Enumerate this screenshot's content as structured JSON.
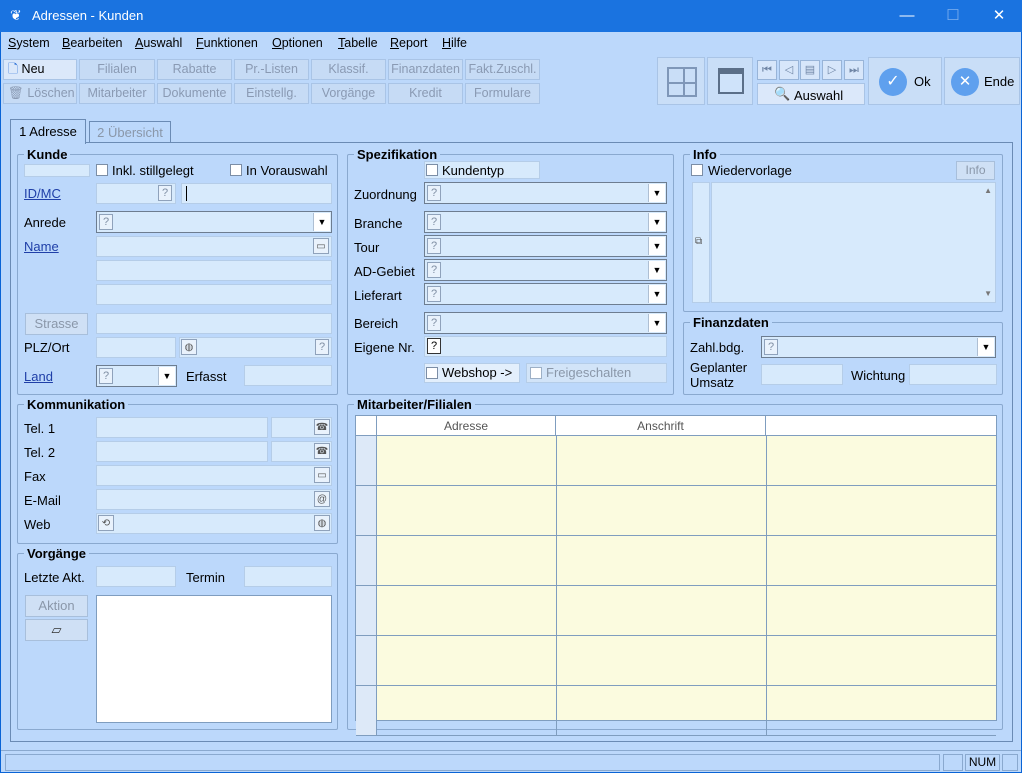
{
  "window": {
    "title": "Adressen - Kunden",
    "minimize": "—",
    "maximize": "☐",
    "close": "✕"
  },
  "menu": [
    {
      "label": "System",
      "u": "S"
    },
    {
      "label": "Bearbeiten",
      "u": "B"
    },
    {
      "label": "Auswahl",
      "u": "A"
    },
    {
      "label": "Funktionen",
      "u": "F"
    },
    {
      "label": "Optionen",
      "u": "O"
    },
    {
      "label": "Tabelle",
      "u": "T"
    },
    {
      "label": "Report",
      "u": "R"
    },
    {
      "label": "Hilfe",
      "u": "H"
    }
  ],
  "toolbar": {
    "neu": "Neu",
    "loeschen": "Löschen",
    "row1": [
      "Filialen",
      "Rabatte",
      "Pr.-Listen",
      "Klassif.",
      "Finanzdaten",
      "Fakt.Zuschl."
    ],
    "row2": [
      "Mitarbeiter",
      "Dokumente",
      "Einstellg.",
      "Vorgänge",
      "Kredit",
      "Formulare"
    ],
    "auswahl": "Auswahl",
    "ok": "Ok",
    "ende": "Ende"
  },
  "tabs": {
    "t1": "1 Adresse",
    "t2": "2 Übersicht"
  },
  "kunde": {
    "title": "Kunde",
    "inkl": "Inkl. stillgelegt",
    "vorauswahl": "In Vorauswahl",
    "idmc": "ID/MC",
    "anrede": "Anrede",
    "name": "Name",
    "strasse": "Strasse",
    "plzort": "PLZ/Ort",
    "land": "Land",
    "erfasst": "Erfasst"
  },
  "spez": {
    "title": "Spezifikation",
    "kundentyp": "Kundentyp",
    "zuordnung": "Zuordnung",
    "branche": "Branche",
    "tour": "Tour",
    "adgebiet": "AD-Gebiet",
    "lieferart": "Lieferart",
    "bereich": "Bereich",
    "eigene": "Eigene Nr.",
    "webshop": "Webshop ->",
    "freigeschaltet": "Freigeschalten"
  },
  "info": {
    "title": "Info",
    "wiedervorlage": "Wiedervorlage",
    "button": "Info"
  },
  "finanz": {
    "title": "Finanzdaten",
    "zahl": "Zahl.bdg.",
    "geplant1": "Geplanter",
    "geplant2": "Umsatz",
    "wichtung": "Wichtung"
  },
  "komm": {
    "title": "Kommunikation",
    "tel1": "Tel. 1",
    "tel2": "Tel. 2",
    "fax": "Fax",
    "email": "E-Mail",
    "web": "Web"
  },
  "vorg": {
    "title": "Vorgänge",
    "letzte": "Letzte Akt.",
    "termin": "Termin",
    "aktion": "Aktion"
  },
  "mitarbeiter": {
    "title": "Mitarbeiter/Filialen",
    "columns": [
      "Adresse",
      "Anschrift",
      ""
    ]
  },
  "status": {
    "num": "NUM"
  },
  "colors": {
    "titlebar": "#1a73e0",
    "background": "#bcd8fb",
    "field": "#d7eafc",
    "grid": "#fbfbdf"
  }
}
